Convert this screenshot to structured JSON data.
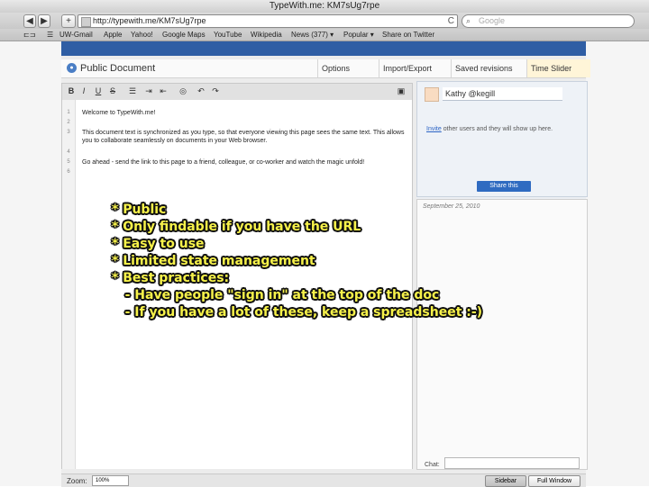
{
  "window": {
    "title": "TypeWith.me: KM7sUg7rpe"
  },
  "toolbar": {
    "back_label": "◀",
    "forward_label": "▶",
    "add_label": "+",
    "url": "http://typewith.me/KM7sUg7rpe",
    "reload_glyph": "C",
    "search_placeholder": "Google"
  },
  "bookmarks": [
    "UW-Gmail",
    "Apple",
    "Yahoo!",
    "Google Maps",
    "YouTube",
    "Wikipedia",
    "News (377) ▾",
    "Popular ▾",
    "Share on Twitter"
  ],
  "doc": {
    "title": "Public Document",
    "tabs": [
      "Options",
      "Import/Export",
      "Saved revisions",
      "Time Slider"
    ]
  },
  "editor": {
    "line_numbers": [
      "1",
      "2",
      "3",
      "4",
      "5",
      "6"
    ],
    "lines": [
      "Welcome to TypeWith.me!",
      "This document text is synchronized as you type, so that everyone viewing this page sees the same text. This allows you to collaborate seamlessly on documents in your Web browser.",
      "Go ahead - send the link to this page to a friend, colleague, or co-worker and watch the magic unfold!"
    ]
  },
  "sidebar": {
    "username": "Kathy @kegill",
    "invite_link": "Invite",
    "invite_text": "other users and they will show up here.",
    "share_button": "Share this",
    "chat_date": "September 25, 2010",
    "chat_label": "Chat:"
  },
  "bottom": {
    "zoom_label": "Zoom:",
    "zoom_value": "100%",
    "sidebar_button": "Sidebar",
    "fullwindow_button": "Full Window"
  },
  "overlay": {
    "lines": [
      "* Public",
      "* Only findable if you have the URL",
      "* Easy to use",
      "* Limited state management",
      "* Best practices:",
      "   - Have people \"sign in\" at the top of the doc",
      "   - If you have a lot of these, keep a spreadsheet :-)"
    ]
  },
  "colors": {
    "accent_blue": "#2f5ea4",
    "overlay_text": "#f7f24a",
    "link": "#2b63c5"
  }
}
